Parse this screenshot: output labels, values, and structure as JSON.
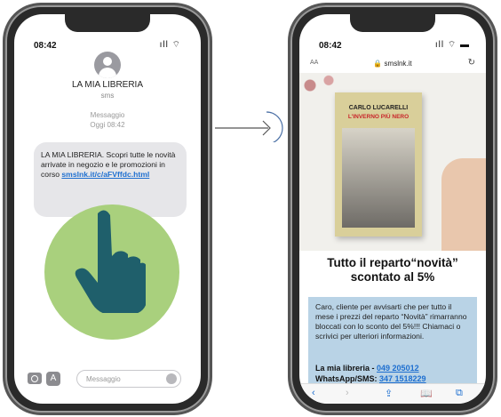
{
  "left_phone": {
    "time": "08:42",
    "signal": "ıll ⌔",
    "contact_name": "LA MIA LIBRERIA",
    "contact_type": "sms",
    "message_label": "Messaggio",
    "message_time": "Oggi 08:42",
    "message_text": "LA MIA LIBRERIA. Scopri tutte le novità arrivate in negozio e le promozioni in corso ",
    "message_link": "smslnk.it/c/aFVffdc.html",
    "input_placeholder": "Messaggio",
    "app_store_glyph": "A"
  },
  "right_phone": {
    "time": "08:42",
    "signal": "ıll ⌔ ▬",
    "text_size_label": "AA",
    "url": "🔒 smslnk.it",
    "reload_glyph": "↻",
    "book_author": "CARLO LUCARELLI",
    "book_title": "L'INVERNO PIÙ NERO",
    "headline_line1": "Tutto il reparto“novità”",
    "headline_line2": "scontato al 5%",
    "body_text": "Caro, cliente per avvisarti che per tutto il mese i prezzi del reparto “Novità” rimarranno bloccati con lo sconto del 5%!!! Chiamaci o scrivici per ulteriori informazioni.",
    "contact_label1": "La mia libreria - ",
    "contact_phone1": "049 205012",
    "contact_label2": "WhatsApp/SMS: ",
    "contact_phone2": "347 1518229",
    "toolbar": [
      "‹",
      "›",
      "⇪",
      "📖",
      "⧉"
    ]
  },
  "colors": {
    "accent_link": "#1e6fd0",
    "circle_green": "#a9d07d",
    "hand_teal": "#1f5f6b",
    "info_blue": "#b9d3e6",
    "arrow_blue": "#4a6fa5"
  },
  "icons": [
    "camera-icon",
    "app-store-icon",
    "pointing-hand-icon",
    "arrow-right-icon",
    "lock-icon",
    "reload-icon"
  ]
}
